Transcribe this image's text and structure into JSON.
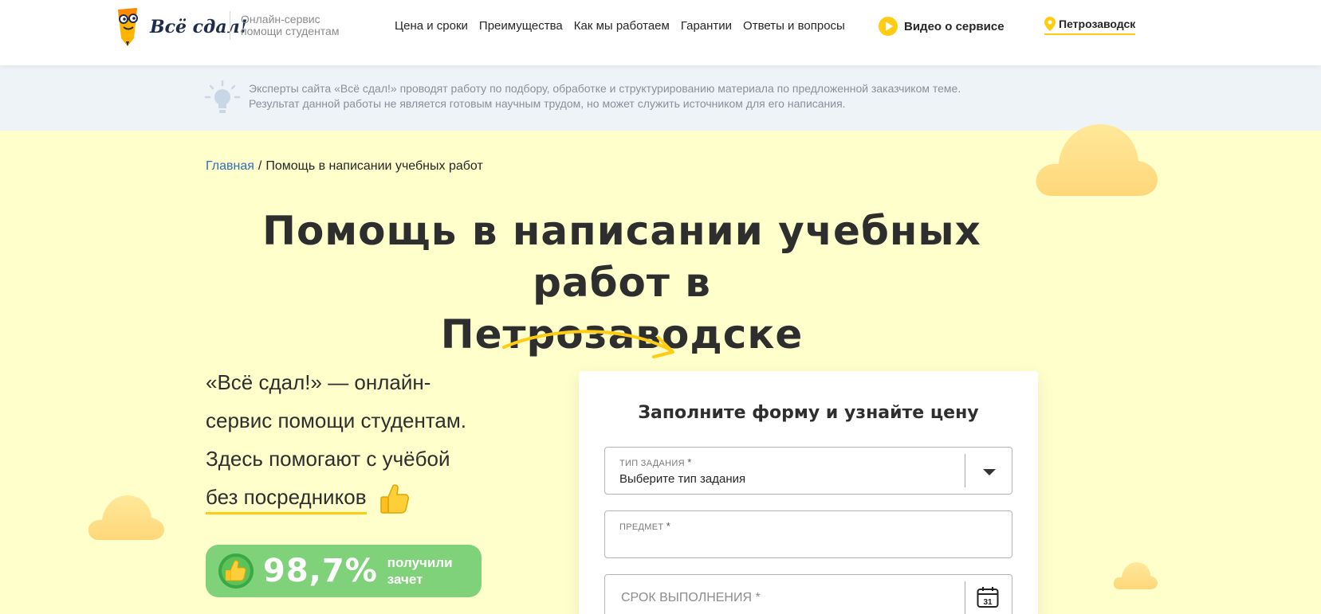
{
  "header": {
    "logo_text": "Всё сдал!",
    "tagline_line1": "Онлайн-сервис",
    "tagline_line2": "помощи студентам",
    "nav": [
      {
        "label": "Цена и сроки"
      },
      {
        "label": "Преимущества"
      },
      {
        "label": "Как мы работаем"
      },
      {
        "label": "Гарантии"
      },
      {
        "label": "Ответы и вопросы"
      }
    ],
    "video_label": "Видео о сервисе",
    "city": "Петрозаводск"
  },
  "disclaimer": {
    "line1": "Эксперты сайта «Всё сдал!» проводят работу по подбору, обработке и структурированию материала по предложенной заказчиком теме.",
    "line2": "Результат данной работы не является готовым научным трудом, но может служить источником для его написания."
  },
  "breadcrumb": {
    "home": "Главная",
    "separator": "/",
    "current": "Помощь в написании учебных работ"
  },
  "title": {
    "line1": "Помощь в написании учебных работ в",
    "line2": "Петрозаводске"
  },
  "intro": {
    "line1": "«Всё сдал!» — онлайн-",
    "line2": "сервис помощи студентам.",
    "line3": "Здесь помогают с учёбой",
    "highlight": "без посредников"
  },
  "stats": {
    "value": "98,7%",
    "label_line1": "получили",
    "label_line2": "зачет"
  },
  "form": {
    "title": "Заполните форму и узнайте цену",
    "type_label": "ТИП ЗАДАНИЯ",
    "type_value": "Выберите тип задания",
    "subject_label": "ПРЕДМЕТ",
    "deadline_placeholder": "СРОК ВЫПОЛНЕНИЯ *",
    "required_mark": "*",
    "calendar_day": "31"
  },
  "colors": {
    "accent_yellow": "#ffcc12",
    "page_bg": "#ffffcc",
    "disclaimer_bg": "#eef3f8",
    "stats_green": "#7fd17a",
    "link_blue": "#2f6fb8"
  }
}
